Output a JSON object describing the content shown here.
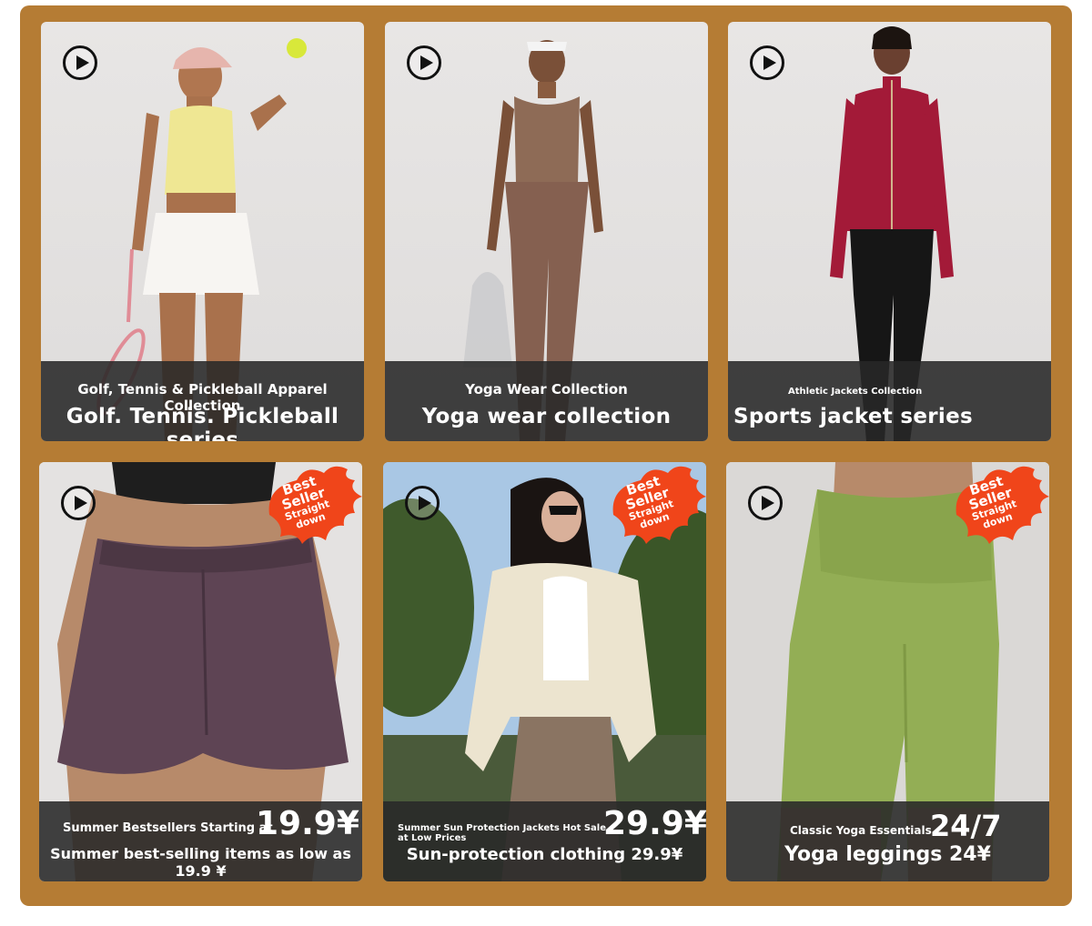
{
  "cards": [
    {
      "small_label": "Golf, Tennis & Pickleball Apparel Collection",
      "big_label": "Golf. Tennis. Pickleball series"
    },
    {
      "small_label": "Yoga Wear Collection",
      "big_label": "Yoga wear collection"
    },
    {
      "small_label": "Athletic Jackets Collection",
      "big_label": "Sports jacket series"
    },
    {
      "promo_label": "Summer Bestsellers Starting at",
      "price": "19.9¥",
      "second_label": "Summer best-selling items as low as 19.9 ¥",
      "badge": [
        "Best",
        "Seller",
        "Straight",
        "down"
      ]
    },
    {
      "promo_label": "Summer Sun Protection Jackets Hot Sale at Low Prices",
      "price": "29.9¥",
      "second_label": "Sun-protection clothing 29.9¥",
      "badge": [
        "Best",
        "Seller",
        "Straight",
        "down"
      ]
    },
    {
      "promo_label": "Classic Yoga Essentials",
      "price": "24/7",
      "second_label": "Yoga leggings 24¥",
      "badge": [
        "Best",
        "Seller",
        "Straight",
        "down"
      ]
    }
  ],
  "colors": {
    "frame": "#b57c34",
    "caption_bg": "#282828",
    "badge_flame": "#f0451a"
  },
  "icons": [
    "play-icon",
    "flame-badge-icon"
  ]
}
